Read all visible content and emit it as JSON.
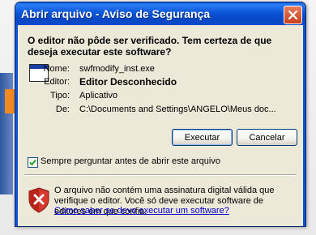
{
  "window": {
    "title": "Abrir arquivo - Aviso de Segurança"
  },
  "heading": "O editor não pôde ser verificado.  Tem certeza de que deseja executar este software?",
  "details": {
    "name_label": "Nome:",
    "name_value": "swfmodify_inst.exe",
    "publisher_label": "Editor:",
    "publisher_value": "Editor Desconhecido",
    "type_label": "Tipo:",
    "type_value": "Aplicativo",
    "from_label": "De:",
    "from_value": "C:\\Documents and Settings\\ANGELO\\Meus doc..."
  },
  "buttons": {
    "run": "Executar",
    "cancel": "Cancelar"
  },
  "checkbox": {
    "label": "Sempre perguntar antes de abrir este arquivo",
    "checked": true
  },
  "warning": {
    "text": "O arquivo não contém uma assinatura digital válida que verifique o editor.  Você só deve executar software de editores em que confia.",
    "link": "Como saber se devo executar um software?"
  }
}
